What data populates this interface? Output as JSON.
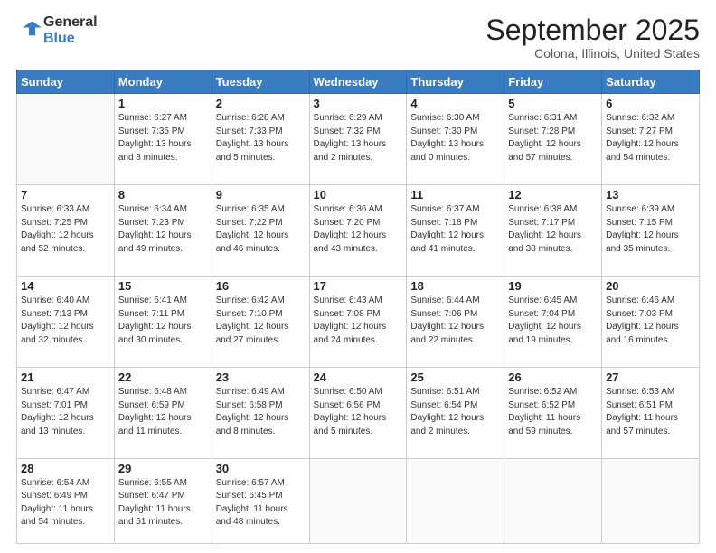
{
  "header": {
    "logo_general": "General",
    "logo_blue": "Blue",
    "month_title": "September 2025",
    "location": "Colona, Illinois, United States"
  },
  "weekdays": [
    "Sunday",
    "Monday",
    "Tuesday",
    "Wednesday",
    "Thursday",
    "Friday",
    "Saturday"
  ],
  "weeks": [
    [
      {
        "day": "",
        "info": ""
      },
      {
        "day": "1",
        "info": "Sunrise: 6:27 AM\nSunset: 7:35 PM\nDaylight: 13 hours\nand 8 minutes."
      },
      {
        "day": "2",
        "info": "Sunrise: 6:28 AM\nSunset: 7:33 PM\nDaylight: 13 hours\nand 5 minutes."
      },
      {
        "day": "3",
        "info": "Sunrise: 6:29 AM\nSunset: 7:32 PM\nDaylight: 13 hours\nand 2 minutes."
      },
      {
        "day": "4",
        "info": "Sunrise: 6:30 AM\nSunset: 7:30 PM\nDaylight: 13 hours\nand 0 minutes."
      },
      {
        "day": "5",
        "info": "Sunrise: 6:31 AM\nSunset: 7:28 PM\nDaylight: 12 hours\nand 57 minutes."
      },
      {
        "day": "6",
        "info": "Sunrise: 6:32 AM\nSunset: 7:27 PM\nDaylight: 12 hours\nand 54 minutes."
      }
    ],
    [
      {
        "day": "7",
        "info": "Sunrise: 6:33 AM\nSunset: 7:25 PM\nDaylight: 12 hours\nand 52 minutes."
      },
      {
        "day": "8",
        "info": "Sunrise: 6:34 AM\nSunset: 7:23 PM\nDaylight: 12 hours\nand 49 minutes."
      },
      {
        "day": "9",
        "info": "Sunrise: 6:35 AM\nSunset: 7:22 PM\nDaylight: 12 hours\nand 46 minutes."
      },
      {
        "day": "10",
        "info": "Sunrise: 6:36 AM\nSunset: 7:20 PM\nDaylight: 12 hours\nand 43 minutes."
      },
      {
        "day": "11",
        "info": "Sunrise: 6:37 AM\nSunset: 7:18 PM\nDaylight: 12 hours\nand 41 minutes."
      },
      {
        "day": "12",
        "info": "Sunrise: 6:38 AM\nSunset: 7:17 PM\nDaylight: 12 hours\nand 38 minutes."
      },
      {
        "day": "13",
        "info": "Sunrise: 6:39 AM\nSunset: 7:15 PM\nDaylight: 12 hours\nand 35 minutes."
      }
    ],
    [
      {
        "day": "14",
        "info": "Sunrise: 6:40 AM\nSunset: 7:13 PM\nDaylight: 12 hours\nand 32 minutes."
      },
      {
        "day": "15",
        "info": "Sunrise: 6:41 AM\nSunset: 7:11 PM\nDaylight: 12 hours\nand 30 minutes."
      },
      {
        "day": "16",
        "info": "Sunrise: 6:42 AM\nSunset: 7:10 PM\nDaylight: 12 hours\nand 27 minutes."
      },
      {
        "day": "17",
        "info": "Sunrise: 6:43 AM\nSunset: 7:08 PM\nDaylight: 12 hours\nand 24 minutes."
      },
      {
        "day": "18",
        "info": "Sunrise: 6:44 AM\nSunset: 7:06 PM\nDaylight: 12 hours\nand 22 minutes."
      },
      {
        "day": "19",
        "info": "Sunrise: 6:45 AM\nSunset: 7:04 PM\nDaylight: 12 hours\nand 19 minutes."
      },
      {
        "day": "20",
        "info": "Sunrise: 6:46 AM\nSunset: 7:03 PM\nDaylight: 12 hours\nand 16 minutes."
      }
    ],
    [
      {
        "day": "21",
        "info": "Sunrise: 6:47 AM\nSunset: 7:01 PM\nDaylight: 12 hours\nand 13 minutes."
      },
      {
        "day": "22",
        "info": "Sunrise: 6:48 AM\nSunset: 6:59 PM\nDaylight: 12 hours\nand 11 minutes."
      },
      {
        "day": "23",
        "info": "Sunrise: 6:49 AM\nSunset: 6:58 PM\nDaylight: 12 hours\nand 8 minutes."
      },
      {
        "day": "24",
        "info": "Sunrise: 6:50 AM\nSunset: 6:56 PM\nDaylight: 12 hours\nand 5 minutes."
      },
      {
        "day": "25",
        "info": "Sunrise: 6:51 AM\nSunset: 6:54 PM\nDaylight: 12 hours\nand 2 minutes."
      },
      {
        "day": "26",
        "info": "Sunrise: 6:52 AM\nSunset: 6:52 PM\nDaylight: 11 hours\nand 59 minutes."
      },
      {
        "day": "27",
        "info": "Sunrise: 6:53 AM\nSunset: 6:51 PM\nDaylight: 11 hours\nand 57 minutes."
      }
    ],
    [
      {
        "day": "28",
        "info": "Sunrise: 6:54 AM\nSunset: 6:49 PM\nDaylight: 11 hours\nand 54 minutes."
      },
      {
        "day": "29",
        "info": "Sunrise: 6:55 AM\nSunset: 6:47 PM\nDaylight: 11 hours\nand 51 minutes."
      },
      {
        "day": "30",
        "info": "Sunrise: 6:57 AM\nSunset: 6:45 PM\nDaylight: 11 hours\nand 48 minutes."
      },
      {
        "day": "",
        "info": ""
      },
      {
        "day": "",
        "info": ""
      },
      {
        "day": "",
        "info": ""
      },
      {
        "day": "",
        "info": ""
      }
    ]
  ]
}
